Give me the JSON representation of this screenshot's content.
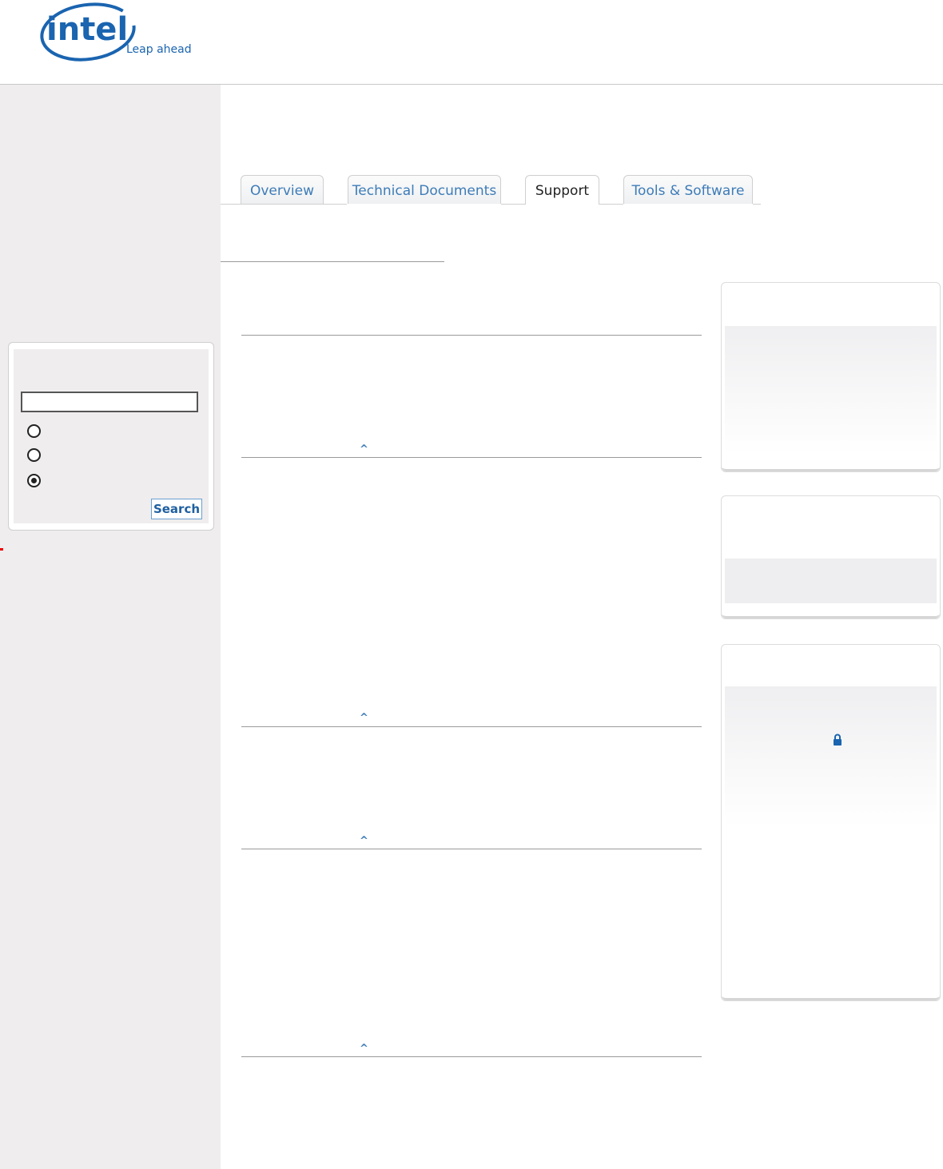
{
  "brand": {
    "logo_wordmark": "intel",
    "logo_tagline": "Leap ahead"
  },
  "tabs": [
    {
      "label": "Overview",
      "active": false
    },
    {
      "label": "Technical Documents",
      "active": false
    },
    {
      "label": "Support",
      "active": true
    },
    {
      "label": "Tools & Software",
      "active": false
    }
  ],
  "search": {
    "input_value": "",
    "radio_options": [
      {
        "checked": false
      },
      {
        "checked": false
      },
      {
        "checked": true
      }
    ],
    "button_label": "Search"
  },
  "sections": {
    "back_to_top_label": "^"
  },
  "icons": {
    "lock": "lock-icon"
  },
  "colors": {
    "link_blue": "#3d7cb8",
    "logo_blue": "#1a64b0",
    "sidebar_bg": "#efedee"
  }
}
